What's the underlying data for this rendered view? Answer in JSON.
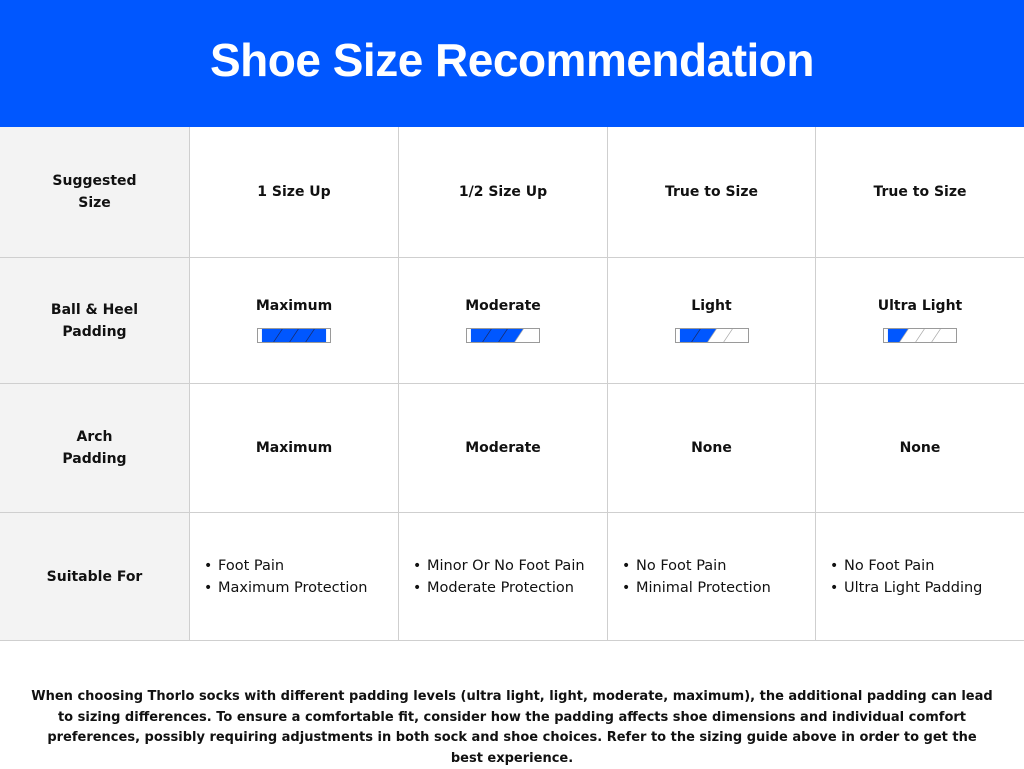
{
  "title": "Shoe Size Recommendation",
  "colors": {
    "brand_blue": "#0057ff",
    "label_bg": "#f3f3f3",
    "grid_line": "#cfcfcf"
  },
  "rows": {
    "suggested_size": {
      "label": "Suggested Size",
      "values": [
        "1 Size Up",
        "1/2 Size Up",
        "True to Size",
        "True to Size"
      ]
    },
    "ball_heel_padding": {
      "label": "Ball & Heel Padding",
      "values": [
        "Maximum",
        "Moderate",
        "Light",
        "Ultra Light"
      ],
      "fill_levels": [
        1.0,
        0.75,
        0.5,
        0.25
      ]
    },
    "arch_padding": {
      "label": "Arch Padding",
      "values": [
        "Maximum",
        "Moderate",
        "None",
        "None"
      ]
    },
    "suitable_for": {
      "label": "Suitable For",
      "values": [
        [
          "Foot Pain",
          "Maximum Protection"
        ],
        [
          "Minor Or No Foot Pain",
          "Moderate Protection"
        ],
        [
          "No Foot Pain",
          "Minimal Protection"
        ],
        [
          "No Foot Pain",
          "Ultra Light Padding"
        ]
      ]
    }
  },
  "footer_note": "When choosing Thorlo socks with different padding levels (ultra light, light, moderate, maximum), the additional padding can lead to sizing differences. To ensure a comfortable fit, consider how the padding affects shoe dimensions and individual comfort preferences, possibly requiring adjustments in both sock and shoe choices. Refer to the sizing guide above in order to get the best experience."
}
